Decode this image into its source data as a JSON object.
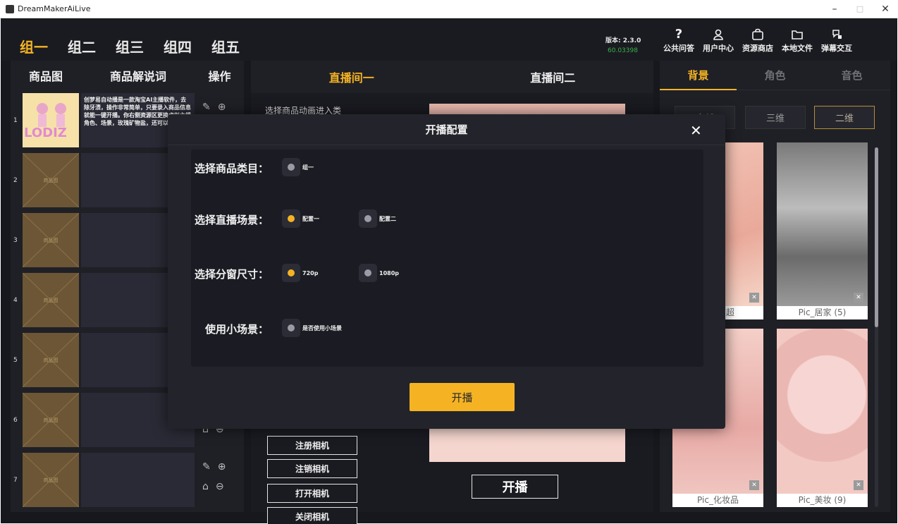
{
  "window": {
    "title": "DreamMakerAiLive",
    "minimize": "–",
    "maximize": "□",
    "close": "✕"
  },
  "groups": [
    "组一",
    "组二",
    "组三",
    "组四",
    "组五"
  ],
  "version": {
    "label": "版本: 2.3.0",
    "fps": "60.03398"
  },
  "toolbar": [
    {
      "label": "公共问答",
      "icon": "question-icon"
    },
    {
      "label": "用户中心",
      "icon": "user-icon"
    },
    {
      "label": "资源商店",
      "icon": "bag-icon"
    },
    {
      "label": "本地文件",
      "icon": "folder-icon"
    },
    {
      "label": "弹幕交互",
      "icon": "chat-icon"
    }
  ],
  "product_table": {
    "headers": [
      "商品图",
      "商品解说词",
      "操作"
    ],
    "rows": [
      {
        "index": "1",
        "desc": "创梦易自动播是一款淘宝AI主播软件，去除牙渍，操作非常简单，只要录入商品信息就能一键开播。你右侧资源区更换虚拟主播角色、场景，玫瑰矿物盐，还可以在",
        "thumb": "LODIZ"
      },
      {
        "index": "2",
        "thumb_label": "商品图"
      },
      {
        "index": "3",
        "thumb_label": "商品图"
      },
      {
        "index": "4",
        "thumb_label": "商品图"
      },
      {
        "index": "5",
        "thumb_label": "商品图"
      },
      {
        "index": "6",
        "thumb_label": "商品图"
      },
      {
        "index": "7",
        "thumb_label": "商品图"
      }
    ]
  },
  "live_rooms": {
    "tabs": [
      "直播间一",
      "直播间二"
    ],
    "select_label": "选择商品动画进入类"
  },
  "camera_buttons": [
    "注册相机",
    "注销相机",
    "打开相机",
    "关闭相机"
  ],
  "start_button": "开播",
  "right_panel": {
    "tabs": [
      "背景",
      "角色",
      "音色"
    ],
    "sub_tabs": [
      "全部",
      "三维",
      "二维"
    ],
    "tiles": [
      "Pic_商超",
      "Pic_居家 (5)",
      "Pic_化妆品",
      "Pic_美妆 (9)"
    ]
  },
  "modal": {
    "title": "开播配置",
    "close": "✕",
    "fields": [
      {
        "label": "选择商品类目：",
        "options": [
          {
            "text": "组一",
            "selected": false
          }
        ]
      },
      {
        "label": "选择直播场景：",
        "options": [
          {
            "text": "配置一",
            "selected": true
          },
          {
            "text": "配置二",
            "selected": false
          }
        ]
      },
      {
        "label": "选择分窗尺寸：",
        "options": [
          {
            "text": "720p",
            "selected": true
          },
          {
            "text": "1080p",
            "selected": false
          }
        ]
      },
      {
        "label": "使用小场景：",
        "options": [
          {
            "text": "是否使用小场景",
            "selected": false
          }
        ]
      }
    ],
    "start": "开播"
  },
  "colors": {
    "accent": "#f5b324",
    "bg": "#17181d",
    "green": "#38b24a"
  }
}
